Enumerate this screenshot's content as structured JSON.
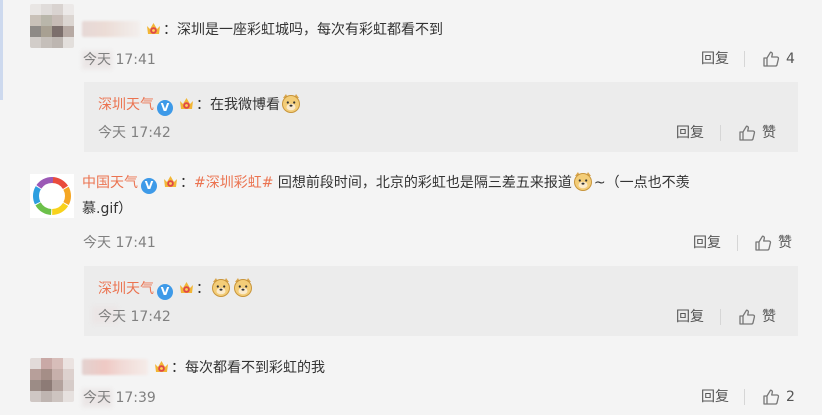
{
  "comments": [
    {
      "text": "：深圳是一座彩虹城吗，每次有彩虹都看不到",
      "time": "今天 17:41",
      "reply_label": "回复",
      "likes": "4"
    },
    {
      "user": "中国天气",
      "hashtag": "#深圳彩虹#",
      "text_before": "回想前段时间，北京的彩虹也是隔三差五来报道",
      "text_after": "~（一点也不羡",
      "text_line2": "慕.gif）",
      "time": "今天 17:41",
      "reply_label": "回复",
      "like_label": "赞"
    },
    {
      "text": "：每次都看不到彩虹的我",
      "time": "今天 17:39",
      "reply_label": "回复",
      "likes": "2"
    }
  ],
  "replies": [
    {
      "user": "深圳天气",
      "text": "：在我微博看",
      "time": "今天 17:42",
      "reply_label": "回复",
      "like_label": "赞"
    },
    {
      "user": "深圳天气",
      "text": "：",
      "time": "今天 17:42",
      "reply_label": "回复",
      "like_label": "赞"
    }
  ],
  "icons": {
    "verified_badge": "V",
    "colors": {
      "username": "#eb7350",
      "verified": "#3e9ae8",
      "timestamp": "#808080"
    }
  }
}
